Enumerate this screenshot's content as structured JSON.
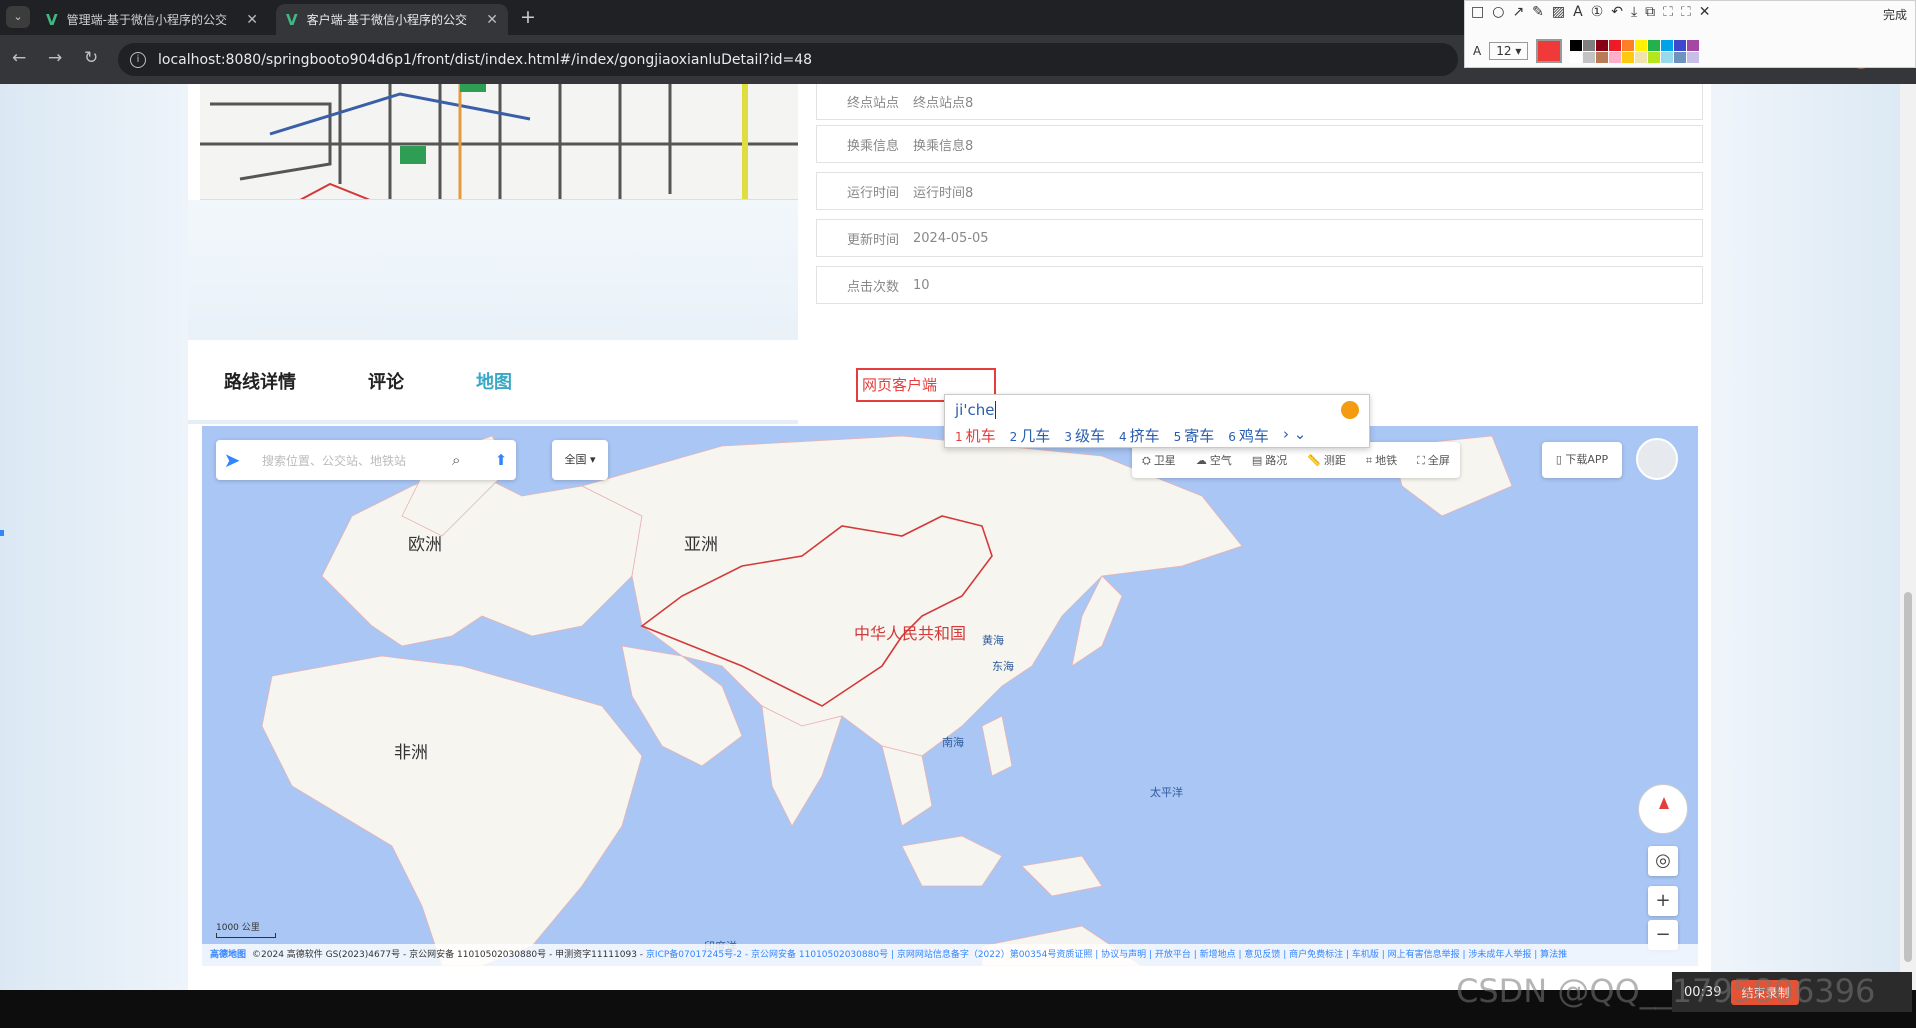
{
  "browser": {
    "tabs": [
      {
        "title": "管理端-基于微信小程序的公交",
        "active": false
      },
      {
        "title": "客户端-基于微信小程序的公交",
        "active": true
      }
    ],
    "url": "localhost:8080/springbooto904d6p1/front/dist/index.html#/index/gongjiaoxianluDetail?id=48"
  },
  "snip_tool": {
    "done_label": "完成",
    "font_size": "12",
    "palette": [
      "#000000",
      "#7f7f7f",
      "#880015",
      "#ed1c24",
      "#ff7f27",
      "#fff200",
      "#22b14c",
      "#00a2e8",
      "#3f48cc",
      "#a349a4",
      "#ffffff",
      "#c3c3c3",
      "#b97a57",
      "#ffaec9",
      "#ffc90e",
      "#efe4b0",
      "#b5e61d",
      "#99d9ea",
      "#7092be",
      "#c8bfe7"
    ]
  },
  "details": [
    {
      "label": "终点站点",
      "value": "终点站点8"
    },
    {
      "label": "换乘信息",
      "value": "换乘信息8"
    },
    {
      "label": "运行时间",
      "value": "运行时间8"
    },
    {
      "label": "更新时间",
      "value": "2024-05-05"
    },
    {
      "label": "点击次数",
      "value": "10"
    }
  ],
  "tabs": [
    {
      "label": "路线详情",
      "active": false
    },
    {
      "label": "评论",
      "active": false
    },
    {
      "label": "地图",
      "active": true
    }
  ],
  "annotation": {
    "text": "网页客户端"
  },
  "ime": {
    "pinyin": "ji'che",
    "candidates": [
      {
        "index": "1",
        "text": "机车"
      },
      {
        "index": "2",
        "text": "几车"
      },
      {
        "index": "3",
        "text": "级车"
      },
      {
        "index": "4",
        "text": "挤车"
      },
      {
        "index": "5",
        "text": "寄车"
      },
      {
        "index": "6",
        "text": "鸡车"
      }
    ]
  },
  "map": {
    "search_placeholder": "搜索位置、公交站、地铁站",
    "region": "全国 ▾",
    "tools": [
      {
        "icon": "satellite-icon",
        "label": "卫星"
      },
      {
        "icon": "air-icon",
        "label": "空气"
      },
      {
        "icon": "traffic-icon",
        "label": "路况"
      },
      {
        "icon": "ruler-icon",
        "label": "测距"
      },
      {
        "icon": "subway-icon",
        "label": "地铁"
      },
      {
        "icon": "fullscreen-icon",
        "label": "全屏"
      }
    ],
    "app_label": "下载APP",
    "labels": {
      "europe": "欧洲",
      "asia": "亚洲",
      "africa": "非洲",
      "china": "中华人民共和国",
      "yellow_sea": "黄海",
      "east_sea": "东海",
      "south_sea": "南海",
      "pacific": "太平洋",
      "indian_ocean": "印度洋"
    },
    "scale": "1000 公里",
    "brand": "高德地图",
    "footer_text": "©2024 高德软件 GS(2023)4677号 - 京公网安备 11010502030880号 - 甲测资字11111093 -",
    "footer_links": "京ICP备07017245号-2 - 京公网安备 11010502030880号 | 京网网站信息备字（2022）第00354号资质证照 | 协议与声明 | 开放平台 | 新增地点 | 意见反馈 | 商户免费标注 | 车机版 | 网上有害信息举报 | 涉未成年人举报 | 算法推"
  },
  "watermark": "CSDN @QQ__1795806396",
  "recorder": {
    "time": "00:39",
    "stop_label": "结束录制"
  }
}
